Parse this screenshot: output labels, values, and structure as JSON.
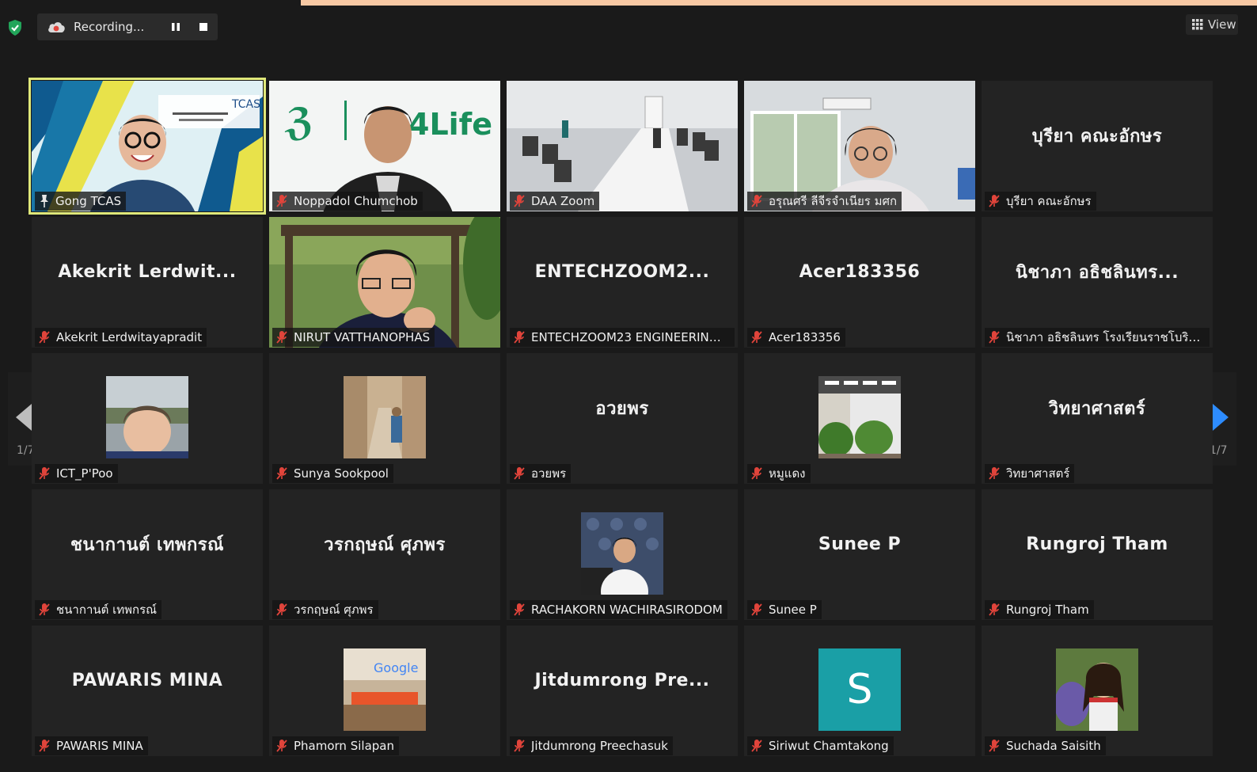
{
  "toolbar": {
    "recording_label": "Recording...",
    "view_label": "View"
  },
  "pagination": {
    "left_label": "1/7",
    "right_label": "1/7"
  },
  "colors": {
    "active_speaker": "#dfe87a",
    "muted_red": "#e0443b",
    "tile_bg": "#232323",
    "accent_top": "#f7c8a3",
    "next_arrow": "#2d8cff",
    "avatar_teal": "#1a9fa6"
  },
  "participants": [
    {
      "name": "Gong TCAS",
      "big": "",
      "kind": "video-gong"
    },
    {
      "name": "Noppadol Chumchob",
      "big": "",
      "kind": "video-nop",
      "logo_text": "4Life"
    },
    {
      "name": "DAA Zoom",
      "big": "",
      "kind": "video-room"
    },
    {
      "name": "อรุณศรี ลีจีรจำเนียร มศก",
      "big": "",
      "kind": "video-office"
    },
    {
      "name": "บุรียา คณะอักษร",
      "big": "บุรียา คณะอักษร",
      "kind": "text"
    },
    {
      "name": "Akekrit Lerdwitayapradit",
      "big": "Akekrit  Lerdwit...",
      "kind": "text"
    },
    {
      "name": "NIRUT VATTHANOPHAS",
      "big": "",
      "kind": "video-nirut"
    },
    {
      "name": "ENTECHZOOM23 ENGINEERING ...",
      "big": "ENTECHZOOM2...",
      "kind": "text"
    },
    {
      "name": "Acer183356",
      "big": "Acer183356",
      "kind": "text"
    },
    {
      "name": "นิชาภา อธิชลินทร โรงเรียนราชโบริกานุ...",
      "big": "นิชาภา อธิชลินทร...",
      "kind": "text"
    },
    {
      "name": "ICT_P'Poo",
      "big": "",
      "kind": "thumb-child"
    },
    {
      "name": "Sunya Sookpool",
      "big": "",
      "kind": "thumb-alley"
    },
    {
      "name": "อวยพร",
      "big": "อวยพร",
      "kind": "text"
    },
    {
      "name": "หมูแดง",
      "big": "",
      "kind": "thumb-plant"
    },
    {
      "name": "วิทยาศาสตร์",
      "big": "วิทยาศาสตร์",
      "kind": "text"
    },
    {
      "name": "ชนากานต์ เทพกรณ์",
      "big": "ชนากานต์ เทพกรณ์",
      "kind": "text"
    },
    {
      "name": "วรกฤษณ์ ศุภพร",
      "big": "วรกฤษณ์ ศุภพร",
      "kind": "text"
    },
    {
      "name": "RACHAKORN WACHIRASIRODOM",
      "big": "",
      "kind": "thumb-man"
    },
    {
      "name": "Sunee P",
      "big": "Sunee P",
      "kind": "text"
    },
    {
      "name": "Rungroj Tham",
      "big": "Rungroj Tham",
      "kind": "text"
    },
    {
      "name": "PAWARIS MINA",
      "big": "PAWARIS MINA",
      "kind": "text"
    },
    {
      "name": "Phamorn Silapan",
      "big": "",
      "kind": "thumb-google",
      "logo_text": "Google"
    },
    {
      "name": "Jitdumrong Preechasuk",
      "big": "Jitdumrong  Pre...",
      "kind": "text"
    },
    {
      "name": "Siriwut Chamtakong",
      "big": "",
      "kind": "avatar",
      "avatar_letter": "S"
    },
    {
      "name": "Suchada Saisith",
      "big": "",
      "kind": "thumb-girl"
    }
  ]
}
